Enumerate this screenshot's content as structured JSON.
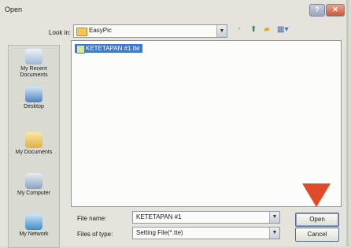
{
  "window": {
    "title": "Open",
    "help_button": "?",
    "close_button": "✕"
  },
  "look_in": {
    "label": "Look in:",
    "value": "EasyPic"
  },
  "toolbar": {
    "icons": [
      "back-icon",
      "up-folder-icon",
      "new-folder-icon",
      "view-menu-icon"
    ]
  },
  "places": [
    {
      "label": "My Recent Documents",
      "icon": "recent-documents-icon"
    },
    {
      "label": "Desktop",
      "icon": "desktop-icon"
    },
    {
      "label": "My Documents",
      "icon": "my-documents-icon"
    },
    {
      "label": "My Computer",
      "icon": "my-computer-icon"
    },
    {
      "label": "My Network",
      "icon": "my-network-icon"
    }
  ],
  "files": [
    {
      "name": "KETETAPAN #1.tte",
      "selected": true
    }
  ],
  "file_name": {
    "label": "File name:",
    "value": "KETETAPAN #1"
  },
  "file_type": {
    "label": "Files of type:",
    "value": "Setting File(*.tte)"
  },
  "buttons": {
    "open": "Open",
    "cancel": "Cancel"
  },
  "colors": {
    "selection": "#3f79c8",
    "annotation_arrow": "#e0492a"
  }
}
